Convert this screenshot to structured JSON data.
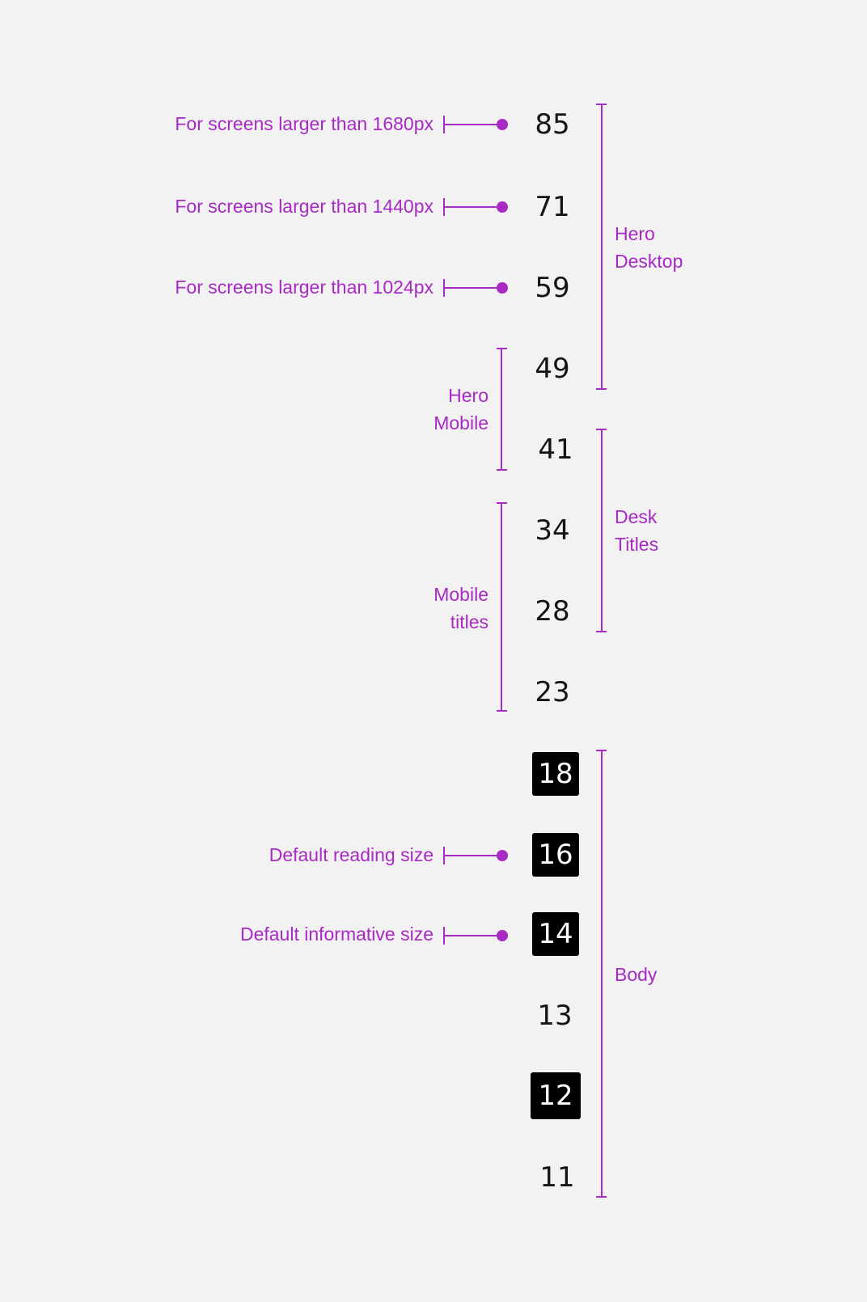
{
  "colors": {
    "background": "#f2f2f2",
    "accent": "#a829c4",
    "text": "#141414",
    "chip_bg": "#000000",
    "chip_text": "#ffffff"
  },
  "sizes": [
    {
      "value": "85",
      "highlighted": false
    },
    {
      "value": "71",
      "highlighted": false
    },
    {
      "value": "59",
      "highlighted": false
    },
    {
      "value": "49",
      "highlighted": false
    },
    {
      "value": "41",
      "highlighted": false
    },
    {
      "value": "34",
      "highlighted": false
    },
    {
      "value": "28",
      "highlighted": false
    },
    {
      "value": "23",
      "highlighted": false
    },
    {
      "value": "18",
      "highlighted": true
    },
    {
      "value": "16",
      "highlighted": true
    },
    {
      "value": "14",
      "highlighted": true
    },
    {
      "value": "13",
      "highlighted": false
    },
    {
      "value": "12",
      "highlighted": true
    },
    {
      "value": "11",
      "highlighted": false
    }
  ],
  "annotations": {
    "screens_1680": "For screens larger than 1680px",
    "screens_1440": "For screens larger than 1440px",
    "screens_1024": "For screens larger than 1024px",
    "default_reading": "Default reading size",
    "default_informative": "Default informative size"
  },
  "groups": {
    "hero_desktop": {
      "line1": "Hero",
      "line2": "Desktop"
    },
    "hero_mobile": {
      "line1": "Hero",
      "line2": "Mobile"
    },
    "desk_titles": {
      "line1": "Desk",
      "line2": "Titles"
    },
    "mobile_titles": {
      "line1": "Mobile",
      "line2": "titles"
    },
    "body": {
      "line1": "Body"
    }
  }
}
